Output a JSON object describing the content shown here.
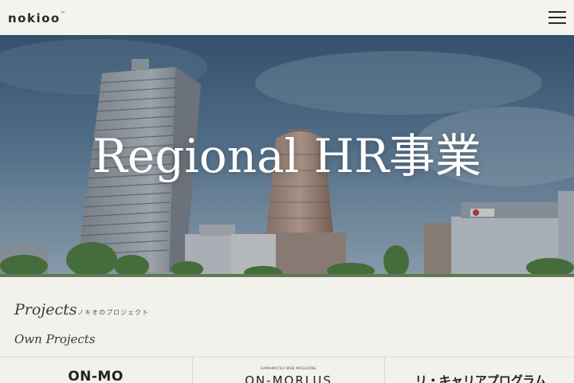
{
  "header": {
    "logo_text": "nokioo",
    "logo_mark": "™",
    "menu_icon": "hamburger-menu-icon"
  },
  "hero": {
    "title": "Regional HR事業"
  },
  "section": {
    "title": "Projects",
    "subtitle": "ノキオのプロジェクト",
    "group_title": "Own Projects"
  },
  "cards": [
    {
      "label": "ON-MO"
    },
    {
      "label": "ON-MORLUS",
      "tagline": "HAMAMATSU  WEB MAGAZINE"
    },
    {
      "label": "リ・キャリアプログラム"
    }
  ],
  "colors": {
    "header_bg": "#f5f3ee",
    "page_bg": "#f3f1ec",
    "hero_title": "#ffffff",
    "text": "#333333"
  }
}
